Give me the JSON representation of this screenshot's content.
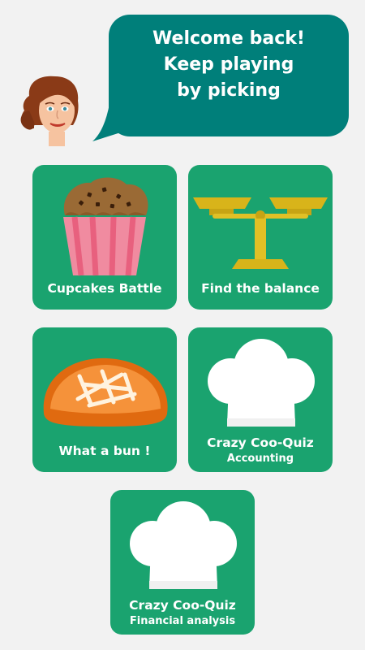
{
  "greeting": {
    "line1": "Welcome back!",
    "line2": "Keep playing",
    "line3": "by picking"
  },
  "games": [
    {
      "title": "Cupcakes Battle",
      "subtitle": "",
      "icon": "cupcake-icon"
    },
    {
      "title": "Find the balance",
      "subtitle": "",
      "icon": "balance-scale-icon"
    },
    {
      "title": "What a bun !",
      "subtitle": "",
      "icon": "bread-bun-icon"
    },
    {
      "title": "Crazy Coo-Quiz",
      "subtitle": "Accounting",
      "icon": "chef-hat-icon"
    },
    {
      "title": "Crazy Coo-Quiz",
      "subtitle": "Financial analysis",
      "icon": "chef-hat-icon"
    }
  ],
  "colors": {
    "background": "#f2f2f2",
    "bubble": "#007f7a",
    "tile": "#1aa36f",
    "text": "#ffffff"
  }
}
